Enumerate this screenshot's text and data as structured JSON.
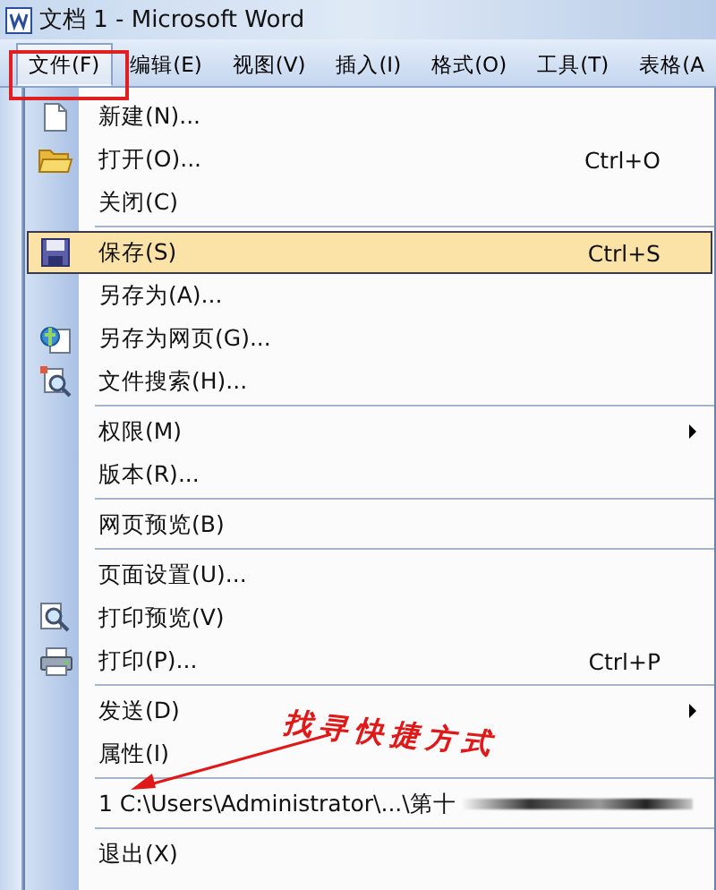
{
  "window": {
    "title": "文档 1 - Microsoft Word"
  },
  "menu_bar": [
    {
      "label": "文件(F)",
      "selected": true
    },
    {
      "label": "编辑(E)",
      "selected": false
    },
    {
      "label": "视图(V)",
      "selected": false
    },
    {
      "label": "插入(I)",
      "selected": false
    },
    {
      "label": "格式(O)",
      "selected": false
    },
    {
      "label": "工具(T)",
      "selected": false
    },
    {
      "label": "表格(A",
      "selected": false
    }
  ],
  "file_menu": [
    {
      "kind": "item",
      "label": "新建(N)...",
      "selected": false
    },
    {
      "kind": "item",
      "label": "打开(O)...",
      "shortcut": "Ctrl+O",
      "selected": false
    },
    {
      "kind": "item",
      "label": "关闭(C)",
      "selected": false
    },
    {
      "kind": "separator"
    },
    {
      "kind": "item",
      "label": "保存(S)",
      "shortcut": "Ctrl+S",
      "selected": true
    },
    {
      "kind": "item",
      "label": "另存为(A)...",
      "selected": false
    },
    {
      "kind": "item",
      "label": "另存为网页(G)...",
      "selected": false
    },
    {
      "kind": "item",
      "label": "文件搜索(H)...",
      "selected": false
    },
    {
      "kind": "separator"
    },
    {
      "kind": "item",
      "label": "权限(M)",
      "submenu": true,
      "selected": false
    },
    {
      "kind": "item",
      "label": "版本(R)...",
      "selected": false
    },
    {
      "kind": "separator"
    },
    {
      "kind": "item",
      "label": "网页预览(B)",
      "selected": false
    },
    {
      "kind": "separator"
    },
    {
      "kind": "item",
      "label": "页面设置(U)...",
      "selected": false
    },
    {
      "kind": "item",
      "label": "打印预览(V)",
      "selected": false
    },
    {
      "kind": "item",
      "label": "打印(P)...",
      "shortcut": "Ctrl+P",
      "selected": false
    },
    {
      "kind": "separator"
    },
    {
      "kind": "item",
      "label": "发送(D)",
      "submenu": true,
      "selected": false
    },
    {
      "kind": "item",
      "label": "属性(I)",
      "selected": false
    },
    {
      "kind": "separator"
    },
    {
      "kind": "recent",
      "label": "1 C:\\Users\\Administrator\\...\\第十",
      "selected": false
    },
    {
      "kind": "separator"
    },
    {
      "kind": "item",
      "label": "退出(X)",
      "selected": false
    }
  ],
  "annotation": {
    "text": "找寻快捷方式"
  }
}
